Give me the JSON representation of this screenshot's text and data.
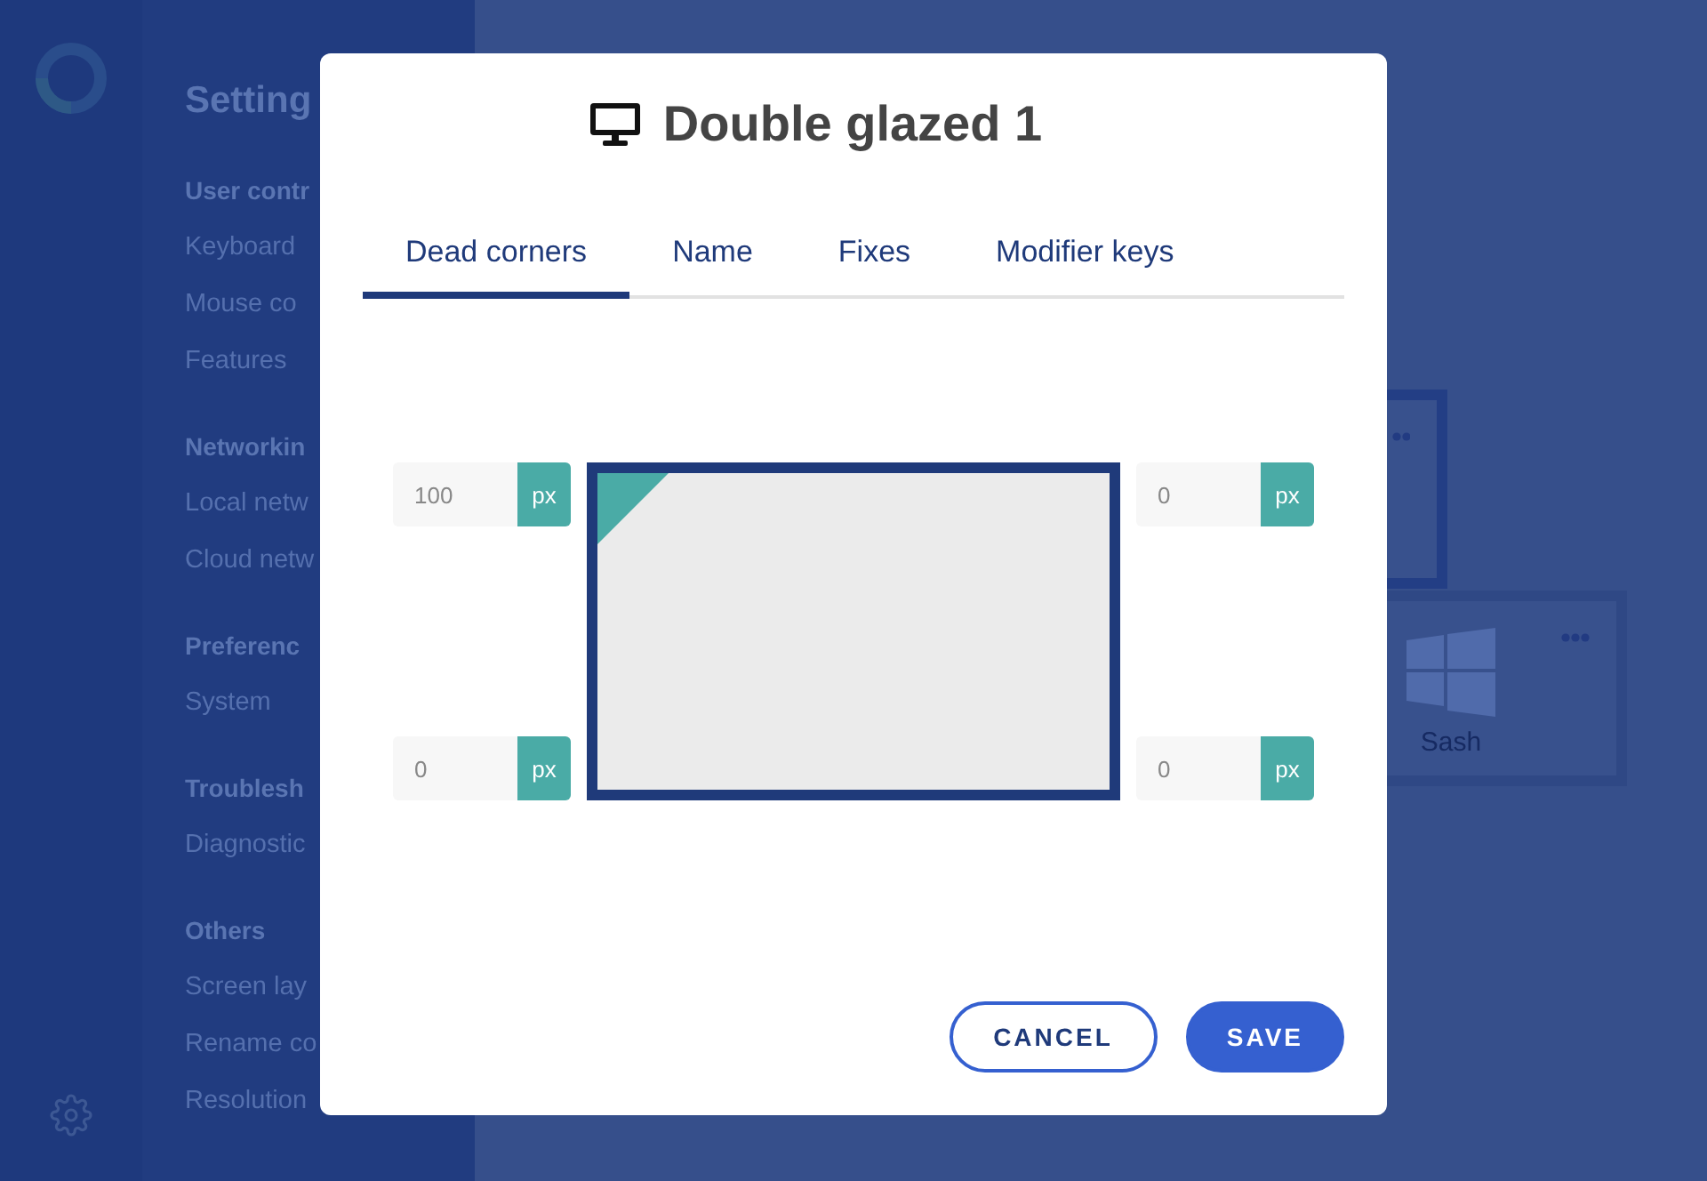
{
  "sidebar": {
    "title": "Setting",
    "sections": [
      {
        "heading": "User contr",
        "items": [
          "Keyboard",
          "Mouse co",
          "Features"
        ]
      },
      {
        "heading": "Networkin",
        "items": [
          "Local netw",
          "Cloud netw"
        ]
      },
      {
        "heading": "Preferenc",
        "items": [
          "System"
        ]
      },
      {
        "heading": "Troublesh",
        "items": [
          "Diagnostic"
        ]
      },
      {
        "heading": "Others",
        "items": [
          "Screen lay",
          "Rename co",
          "Resolution"
        ]
      }
    ]
  },
  "screens": [
    {
      "selected": true
    },
    {
      "selected": false,
      "label": "Sash"
    }
  ],
  "dialog": {
    "title": "Double glazed 1",
    "tabs": [
      {
        "label": "Dead corners",
        "selected": true
      },
      {
        "label": "Name",
        "selected": false
      },
      {
        "label": "Fixes",
        "selected": false
      },
      {
        "label": "Modifier keys",
        "selected": false
      }
    ],
    "corners": [
      {
        "value": "100",
        "unit": "px",
        "dead": true
      },
      {
        "value": "0",
        "unit": "px",
        "dead": false
      },
      {
        "value": "0",
        "unit": "px",
        "dead": false
      },
      {
        "value": "0",
        "unit": "px",
        "dead": false
      }
    ],
    "buttons": [
      {
        "label": "CANCEL",
        "kind": "secondary"
      },
      {
        "label": "SAVE",
        "kind": "primary"
      }
    ]
  }
}
